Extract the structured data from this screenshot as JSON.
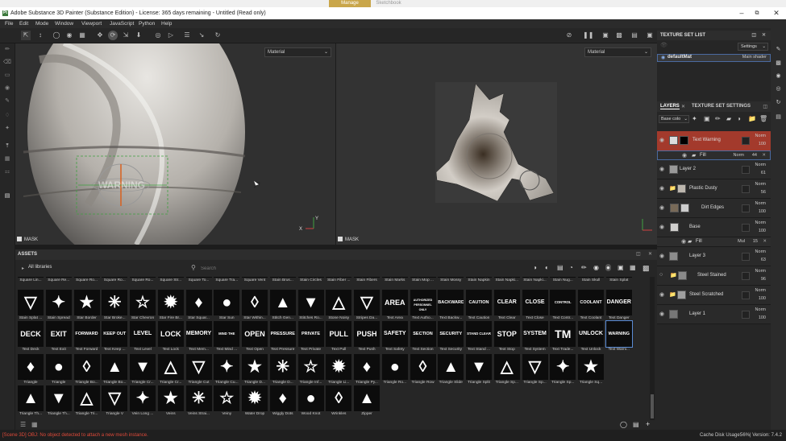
{
  "os_taskbar": {
    "tab_manage": "Manage",
    "tab_sketchbook": "Sketchbook"
  },
  "window": {
    "title": "Adobe Substance 3D Painter (Substance Edition) - License: 365 days remaining - Untitled (Read only)",
    "app_icon": "Pt"
  },
  "menu": [
    "File",
    "Edit",
    "Mode",
    "Window",
    "Viewport",
    "JavaScript",
    "Python",
    "Help"
  ],
  "viewport3d": {
    "dropdown": "Material",
    "mask_label": "MASK",
    "decal_text": "WARNING"
  },
  "viewport2d": {
    "dropdown": "Material",
    "mask_label": "MASK"
  },
  "assets": {
    "title": "ASSETS",
    "library": "All libraries",
    "search_placeholder": "Search",
    "row0": [
      "Square Lin...",
      "Square Re...",
      "Square Ro...",
      "Square Ro...",
      "Square Ro...",
      "Square Str...",
      "Square To...",
      "Square Tra...",
      "Square Vent",
      "Stain Brus...",
      "Stain Circles",
      "Stain Fiber ...",
      "Stain Fibers",
      "Stain Marks",
      "Stain Mop ...",
      "Stain Mossy",
      "Stain Napkin",
      "Stain Napki...",
      "Stain Napki...",
      "Stain Nug...",
      "Stain Skull",
      "Stain Splat"
    ],
    "row1": [
      "Stain Splat ...",
      "Stain Spread",
      "Star Border",
      "Star Broke...",
      "Star Chevron",
      "Star Fire Br...",
      "Star Squar...",
      "Star Sun",
      "Star Within...",
      "Stitch Gen...",
      "Stitches Ro...",
      "Stone Noisy",
      "Stripes Da...",
      "Text Area",
      "Text Autho...",
      "Text Backw...",
      "Text Caution",
      "Text Clear",
      "Text Close",
      "Text Contr...",
      "Text Coolant",
      "Text Danger"
    ],
    "row1_glyphs": [
      "",
      "",
      "",
      "",
      "",
      "",
      "",
      "",
      "",
      "",
      "",
      "",
      "",
      "AREA",
      "AUTHORIZED PERSONNEL ONLY",
      "BACKWARD",
      "CAUTION",
      "CLEAR",
      "CLOSE",
      "CONTROL ROOM",
      "COOLANT",
      "DANGER"
    ],
    "row2": [
      "Text Deck",
      "Text Exit",
      "Text Forward",
      "Text Keep ...",
      "Text Level",
      "Text Lock",
      "Text Mem...",
      "Text Mind ...",
      "Text Open",
      "Text Pressure",
      "Text Private",
      "Text Pull",
      "Text Push",
      "Text Safety",
      "Text Section",
      "Text Security",
      "Text Stand ...",
      "Text Stop",
      "Text System",
      "Text Trade...",
      "Text Unlock",
      "Text Warni..."
    ],
    "row2_glyphs": [
      "DECK",
      "EXIT",
      "FORWARD",
      "KEEP OUT",
      "LEVEL",
      "LOCK",
      "MEMORY",
      "MIND THE STEP",
      "OPEN",
      "PRESSURE",
      "PRIVATE",
      "PULL",
      "PUSH",
      "SAFETY",
      "SECTION",
      "SECURITY",
      "STAND CLEAR",
      "STOP",
      "SYSTEM",
      "TM",
      "UNLOCK",
      "WARNING"
    ],
    "row3": [
      "Triangle",
      "Triangle",
      "Triangle Bo...",
      "Triangle Bo...",
      "Triangle Cr...",
      "Triangle Cr...",
      "Triangle Cut",
      "Triangle Cu...",
      "Triangle D...",
      "Triangle D...",
      "Triangle Inf...",
      "Triangle Li...",
      "Triangle Py...",
      "Triangle Ro...",
      "Triangle Row",
      "Triangle Slide",
      "Triangle Split",
      "Triangle Sp...",
      "Triangle Sp...",
      "Triangle Sp...",
      "Triangle Sq..."
    ],
    "row4": [
      "Triangle Th...",
      "Triangle Th...",
      "Triangle Tri...",
      "Triangle V",
      "Vein Long ...",
      "Veins",
      "Veins Strai...",
      "Veiny",
      "Water Drop",
      "Wiggly Dots",
      "Wood Knot",
      "Wrinkles",
      "Zipper"
    ]
  },
  "status": {
    "message": "[Scene 3D] OBJ: No object detected to attach a new mesh instance.",
    "cache": "Cache Disk Usage:",
    "cache_value": "56%",
    "version": "| Version: 7.4.2"
  },
  "texture_set_list": {
    "title": "TEXTURE SET LIST",
    "settings": "Settings",
    "item": "defaultMat",
    "shader": "Main shader"
  },
  "layers_panel": {
    "tab_layers": "LAYERS",
    "tab_tss": "TEXTURE SET SETTINGS",
    "channel": "Base colo",
    "layers": [
      {
        "name": "Text Warning",
        "blend": "Norm",
        "opacity": "100"
      },
      {
        "name": "Fill",
        "blend": "Norm",
        "opacity": "44"
      },
      {
        "name": "Layer 2",
        "blend": "Norm",
        "opacity": "61"
      },
      {
        "name": "Plastic Dusty",
        "blend": "Norm",
        "opacity": "56"
      },
      {
        "name": "Dirt Edges",
        "blend": "Norm",
        "opacity": "100"
      },
      {
        "name": "Base",
        "blend": "Norm",
        "opacity": "100"
      },
      {
        "name": "Fill",
        "blend": "Mul",
        "opacity": "15"
      },
      {
        "name": "Layer 3",
        "blend": "Norm",
        "opacity": "63"
      },
      {
        "name": "Steel Stained",
        "blend": "Norm",
        "opacity": "96"
      },
      {
        "name": "Steel Scratched",
        "blend": "Norm",
        "opacity": "100"
      },
      {
        "name": "Layer 1",
        "blend": "Norm",
        "opacity": "100"
      }
    ]
  }
}
